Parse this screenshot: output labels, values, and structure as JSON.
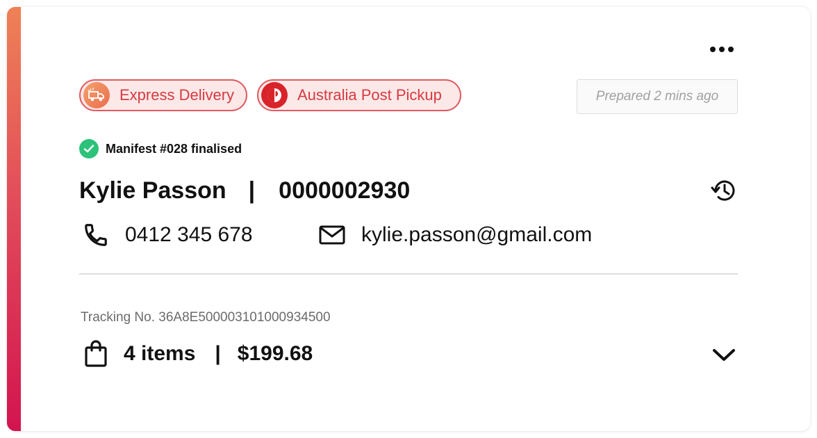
{
  "order_card": {
    "more_menu_icon": "more-horizontal-icon",
    "tags": [
      {
        "label": "Express Delivery",
        "icon": "delivery-truck-icon"
      },
      {
        "label": "Australia Post Pickup",
        "icon": "australia-post-logo-icon"
      }
    ],
    "prepared_text": "Prepared 2 mins ago",
    "manifest_status": "Manifest #028 finalised",
    "customer_name": "Kylie Passon",
    "name_separator": "|",
    "order_number": "0000002930",
    "history_icon": "history-icon",
    "phone": "0412 345 678",
    "email": "kylie.passon@gmail.com",
    "tracking_text": "Tracking No. 36A8E500003101000934500",
    "items_count": "4 items",
    "summary_separator": "|",
    "total": "$199.68",
    "expand_icon": "chevron-down-icon"
  },
  "colors": {
    "accent_gradient_top": "#ee8156",
    "accent_gradient_bottom": "#d3144f",
    "tag_border": "#df5a60",
    "tag_background": "#fde8e8",
    "tag_text": "#d63a40",
    "success_green": "#2cc27a"
  }
}
